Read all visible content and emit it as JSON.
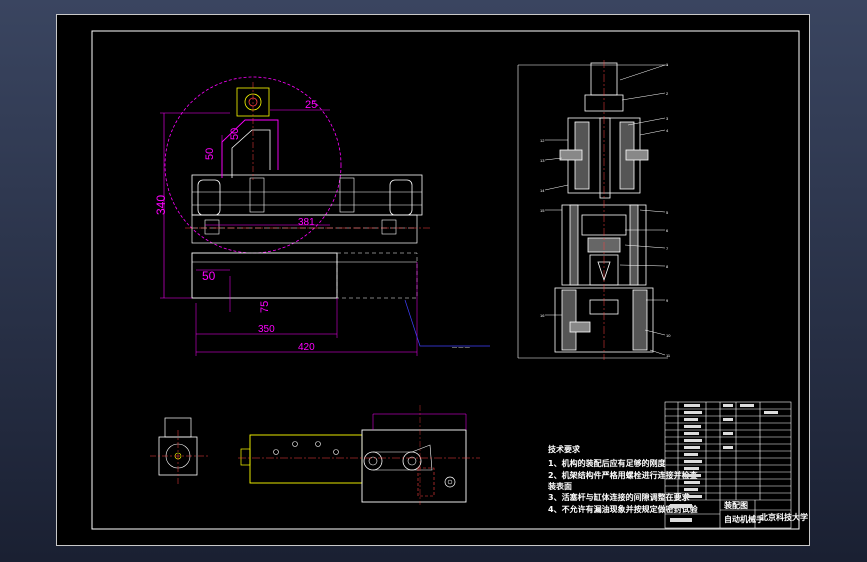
{
  "colors": {
    "paper": "#000000",
    "line": "#ffffff",
    "dim": "#ff00ff",
    "part": "#ffff00",
    "hidden": "#ff4040",
    "leader": "#4040ff"
  },
  "dims": {
    "d25": "25",
    "d50a": "50",
    "d50b": "50",
    "d340": "340",
    "d381": "381",
    "d50c": "50",
    "d75": "75",
    "d350": "350",
    "d420": "420"
  },
  "section_labels": [
    "1",
    "2",
    "3",
    "4",
    "5",
    "6",
    "7",
    "8",
    "9",
    "10",
    "11",
    "12",
    "13",
    "14",
    "15",
    "16"
  ],
  "tech": {
    "title": "技术要求",
    "l1": "1、机构的装配后应有足够的刚度",
    "l2": "2、机架结构件严格用螺栓进行连接并检查",
    "l2b": "装表面",
    "l3": "3、活塞杆与缸体连接的间隙调整在要求",
    "l4": "4、不允许有漏油现象并按规定做密封试验"
  },
  "title_block": {
    "name": "自动机械手",
    "school": "北京科技大学",
    "drawing": "装配图"
  }
}
